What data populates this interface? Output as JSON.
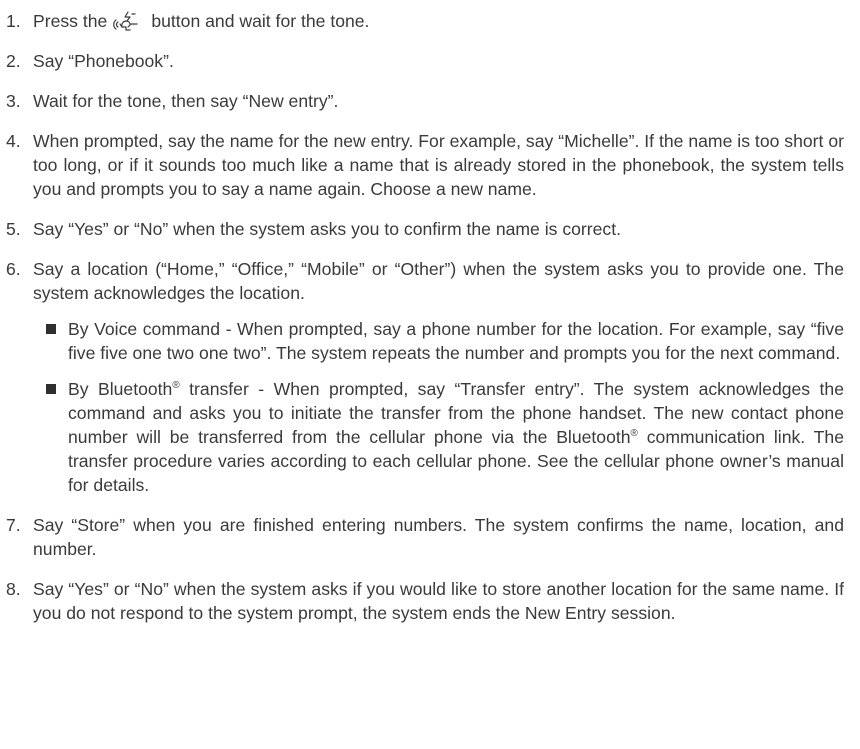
{
  "steps": [
    {
      "num": "1.",
      "before_icon": "Press the",
      "icon": "voice-talk-icon",
      "after_icon": "button and wait for the tone."
    },
    {
      "num": "2.",
      "text": "Say “Phonebook”."
    },
    {
      "num": "3.",
      "text": "Wait for the tone, then say “New entry”."
    },
    {
      "num": "4.",
      "text": "When prompted, say the name for the new entry. For example, say “Michelle”. If the name is too short or too long, or if it sounds too much like a name that is already stored in the phonebook, the system tells you and prompts you to say a name again. Choose a new name."
    },
    {
      "num": "5.",
      "text": "Say “Yes” or “No” when the system asks you to confirm the name is correct."
    },
    {
      "num": "6.",
      "text": "Say a location (“Home,” “Office,” “Mobile” or “Other”) when the system asks you to provide one. The system acknowledges the location."
    },
    {
      "num": "7.",
      "text": "Say “Store” when you are finished entering numbers. The system confirms the name, location, and number."
    },
    {
      "num": "8.",
      "text": "Say “Yes” or “No” when the system asks if you would like to store another location for the same name. If you do not respond to the system prompt, the system ends the New Entry session."
    }
  ],
  "bullets": [
    {
      "text": "By Voice command - When prompted, say a phone number for the location. For example, say “five five five one two one two”. The system repeats the number and prompts you for the next command."
    },
    {
      "part1": "By Bluetooth",
      "sup1": "®",
      "part2": " transfer - When prompted, say “Transfer entry”. The system acknowledges the command and asks you to initiate the transfer from the phone handset. The new contact phone number will be transferred from the cellular phone via the Bluetooth",
      "sup2": "®",
      "part3": " communication link. The transfer procedure varies according to each cellular phone. See the cellular phone owner’s manual for details."
    }
  ]
}
